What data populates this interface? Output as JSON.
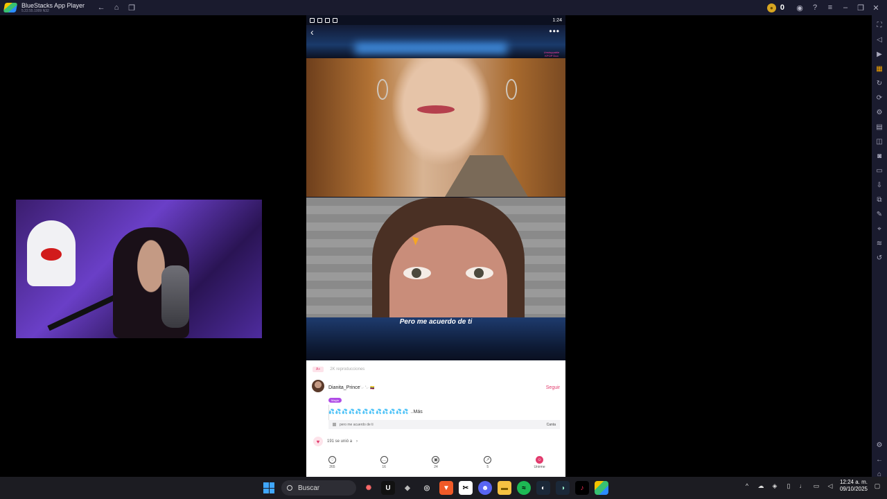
{
  "window": {
    "title": "BlueStacks App Player",
    "version": "5.22.55.1009  N32"
  },
  "titlebar": {
    "coin_count": "0"
  },
  "phone": {
    "status_time": "1:24",
    "kpop_badge": "Unstoppable KPOP Duo",
    "lyric": "Pero me acuerdo de ti"
  },
  "panel": {
    "badge": "A+",
    "reproductions": "2K reproducciones",
    "username": "Dianita_Prince",
    "username_flags": "˚₊‧ ˚₊‧ 🇨🇴",
    "magic_pill": "Magia",
    "follow_label": "Seguir",
    "description_more": "..Más",
    "song_name": "pero me acuerdo de ti",
    "sing_label": "Canta",
    "joined_text": "191 se unió a"
  },
  "actions": [
    {
      "icon": "heart-icon",
      "label": "265"
    },
    {
      "icon": "comment-icon",
      "label": "16"
    },
    {
      "icon": "gift-icon",
      "label": "24"
    },
    {
      "icon": "share-icon",
      "label": "5"
    },
    {
      "icon": "join-icon",
      "label": "Unirme"
    }
  ],
  "taskbar": {
    "search_placeholder": "Buscar",
    "time": "12:24 a. m.",
    "date": "09/10/2025"
  },
  "colors": {
    "accent": "#e23b6d",
    "titlebar_bg": "#1a1b2e",
    "taskbar_bg": "#1c1c22"
  }
}
